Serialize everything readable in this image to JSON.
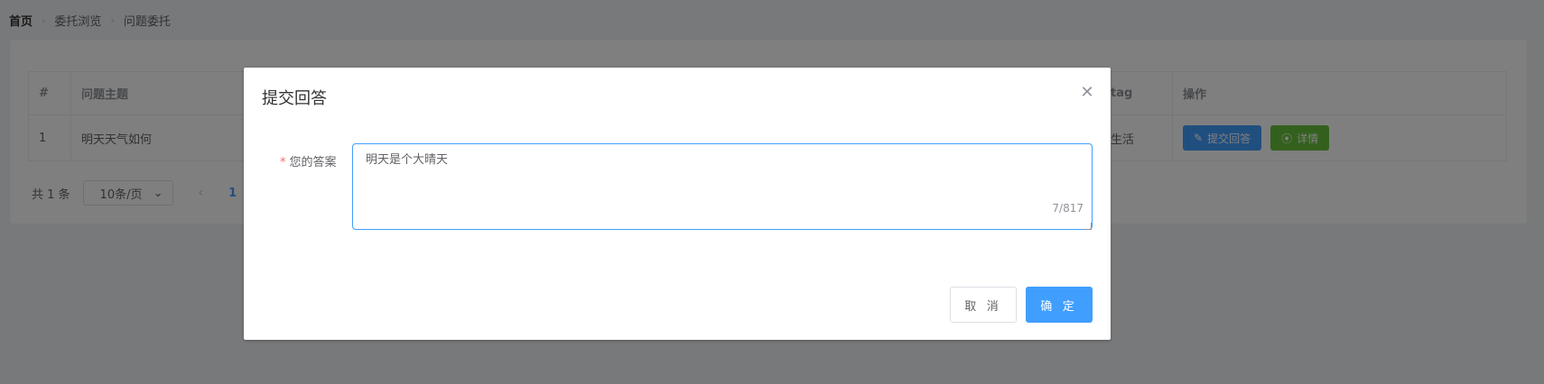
{
  "breadcrumb": [
    "首页",
    "委托浏览",
    "问题委托"
  ],
  "table": {
    "headers": {
      "index": "#",
      "title": "问题主题",
      "tag": "tag",
      "ops": "操作"
    },
    "rows": [
      {
        "index": "1",
        "title": "明天天气如何",
        "tag": "生活",
        "submit_label": "提交回答",
        "detail_label": "详情"
      }
    ]
  },
  "pagination": {
    "total": "共 1 条",
    "page_size": "10条/页",
    "current": "1"
  },
  "dialog": {
    "title": "提交回答",
    "field_label": "您的答案",
    "answer_value": "明天是个大晴天",
    "counter": "7/817",
    "cancel_label": "取 消",
    "confirm_label": "确 定"
  },
  "colors": {
    "primary": "#409eff",
    "success": "#67c23a",
    "danger": "#f56c6c"
  }
}
